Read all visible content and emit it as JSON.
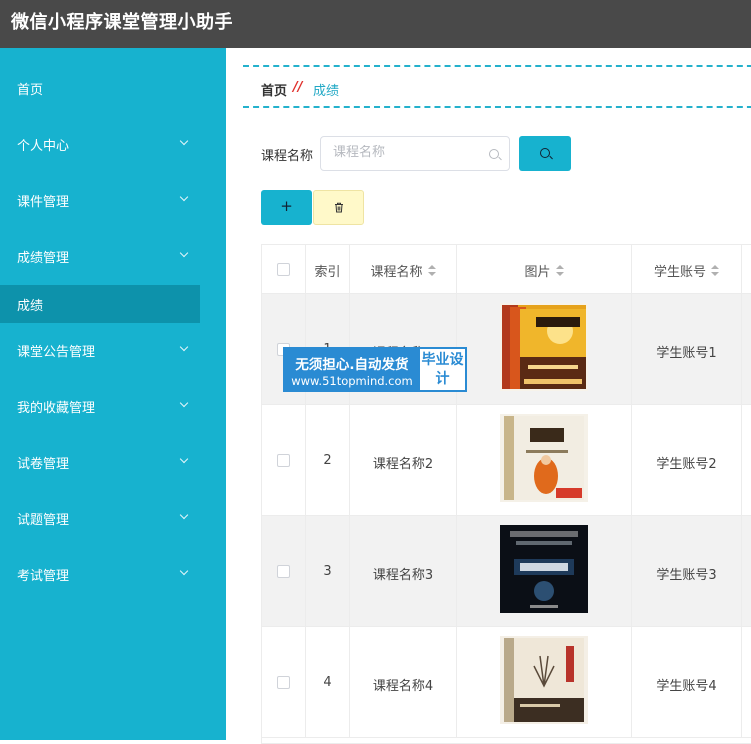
{
  "app": {
    "title": "微信小程序课堂管理小助手"
  },
  "sidebar": {
    "items": [
      {
        "label": "首页",
        "has_chevron": false
      },
      {
        "label": "个人中心",
        "has_chevron": true
      },
      {
        "label": "课件管理",
        "has_chevron": true
      },
      {
        "label": "成绩管理",
        "has_chevron": true
      },
      {
        "label": "成绩",
        "has_chevron": false,
        "active": true
      },
      {
        "label": "课堂公告管理",
        "has_chevron": true
      },
      {
        "label": "我的收藏管理",
        "has_chevron": true
      },
      {
        "label": "试卷管理",
        "has_chevron": true
      },
      {
        "label": "试题管理",
        "has_chevron": true
      },
      {
        "label": "考试管理",
        "has_chevron": true
      }
    ]
  },
  "breadcrumb": {
    "home": "首页",
    "separator": "//",
    "current": "成绩"
  },
  "search": {
    "label": "课程名称",
    "placeholder": "课程名称",
    "value": ""
  },
  "toolbar": {
    "add_label": "+",
    "delete_icon": "trash-icon"
  },
  "table": {
    "headers": {
      "index": "索引",
      "course": "课程名称",
      "image": "图片",
      "student": "学生账号"
    },
    "rows": [
      {
        "index": "1",
        "course": "课程名称1",
        "student": "学生账号1",
        "cover": "book-cover-1"
      },
      {
        "index": "2",
        "course": "课程名称2",
        "student": "学生账号2",
        "cover": "book-cover-2"
      },
      {
        "index": "3",
        "course": "课程名称3",
        "student": "学生账号3",
        "cover": "book-cover-3"
      },
      {
        "index": "4",
        "course": "课程名称4",
        "student": "学生账号4",
        "cover": "book-cover-4"
      }
    ]
  },
  "watermark": {
    "line1": "无须担心.自动发货",
    "line2": "www.51topmind.com",
    "badge": "毕业设计"
  },
  "colors": {
    "accent": "#17b2cf",
    "active": "#0d92ab",
    "topbar": "#494949",
    "danger": "#e0302c"
  }
}
